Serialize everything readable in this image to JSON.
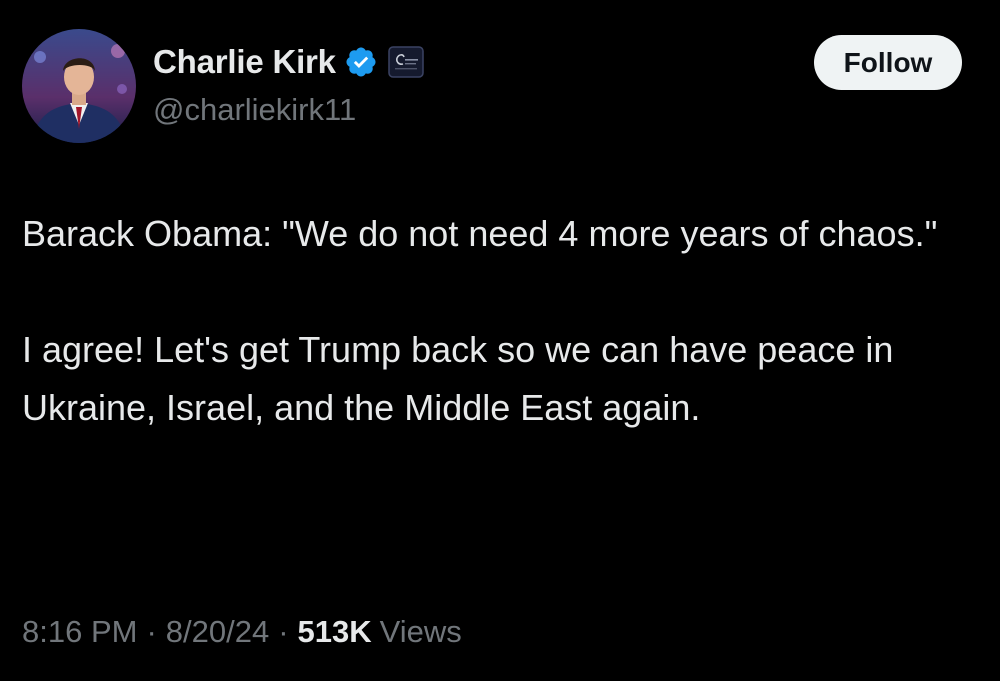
{
  "author": {
    "display_name": "Charlie Kirk",
    "handle": "@charliekirk11",
    "verified_badge_color": "#1d9bf0",
    "affiliation_badge": "organization-logo-icon"
  },
  "follow_button": {
    "label": "Follow"
  },
  "tweet": {
    "paragraphs": [
      "Barack Obama: \"We do not need 4 more years of chaos.\"",
      "I agree! Let's get Trump back so we can have peace in Ukraine, Israel, and the Middle East again."
    ]
  },
  "meta": {
    "time": "8:16 PM",
    "separator": "·",
    "date": "8/20/24",
    "views_count": "513K",
    "views_label": "Views"
  },
  "colors": {
    "background": "#000000",
    "primary_text": "#e7e9ea",
    "secondary_text": "#71767b",
    "follow_button_bg": "#eff3f4",
    "follow_button_text": "#0f1419"
  }
}
